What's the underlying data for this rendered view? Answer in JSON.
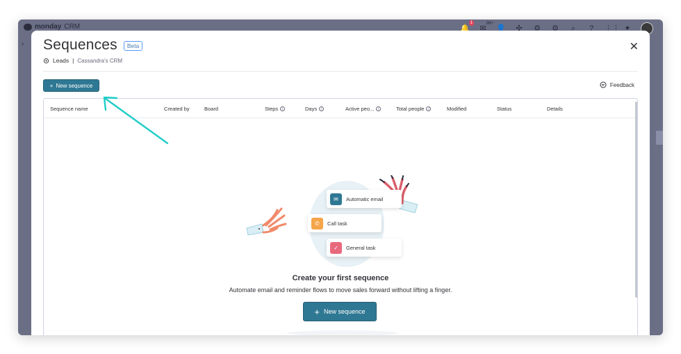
{
  "app": {
    "brand": "monday",
    "product": "CRM"
  },
  "topbar": {
    "notif_badge": "1",
    "inbox_badge": "99+"
  },
  "modal": {
    "title": "Sequences",
    "beta": "Beta",
    "breadcrumb": {
      "item": "Leads",
      "separator": "|",
      "board": "Cassandra's CRM"
    },
    "new_sequence_label": "New sequence",
    "feedback_label": "Feedback"
  },
  "table": {
    "columns": [
      {
        "label": "Sequence name",
        "info": false
      },
      {
        "label": "Created by",
        "info": false
      },
      {
        "label": "Board",
        "info": false
      },
      {
        "label": "Steps",
        "info": true
      },
      {
        "label": "Days",
        "info": true
      },
      {
        "label": "Active peo...",
        "info": true
      },
      {
        "label": "Total people",
        "info": true
      },
      {
        "label": "Modified",
        "info": false
      },
      {
        "label": "Status",
        "info": false
      },
      {
        "label": "Details",
        "info": false
      }
    ]
  },
  "empty_state": {
    "cards": {
      "email": "Automatic email",
      "call": "Call task",
      "general": "General task"
    },
    "title": "Create your first sequence",
    "subtitle": "Automate email and reminder flows to move sales forward without lifting a finger.",
    "button_label": "New sequence"
  },
  "colors": {
    "primary": "#2f7893",
    "arrow": "#1ecdc8",
    "email_icon": "#2f7893",
    "call_icon": "#f5a54a",
    "task_icon": "#e8697d"
  }
}
